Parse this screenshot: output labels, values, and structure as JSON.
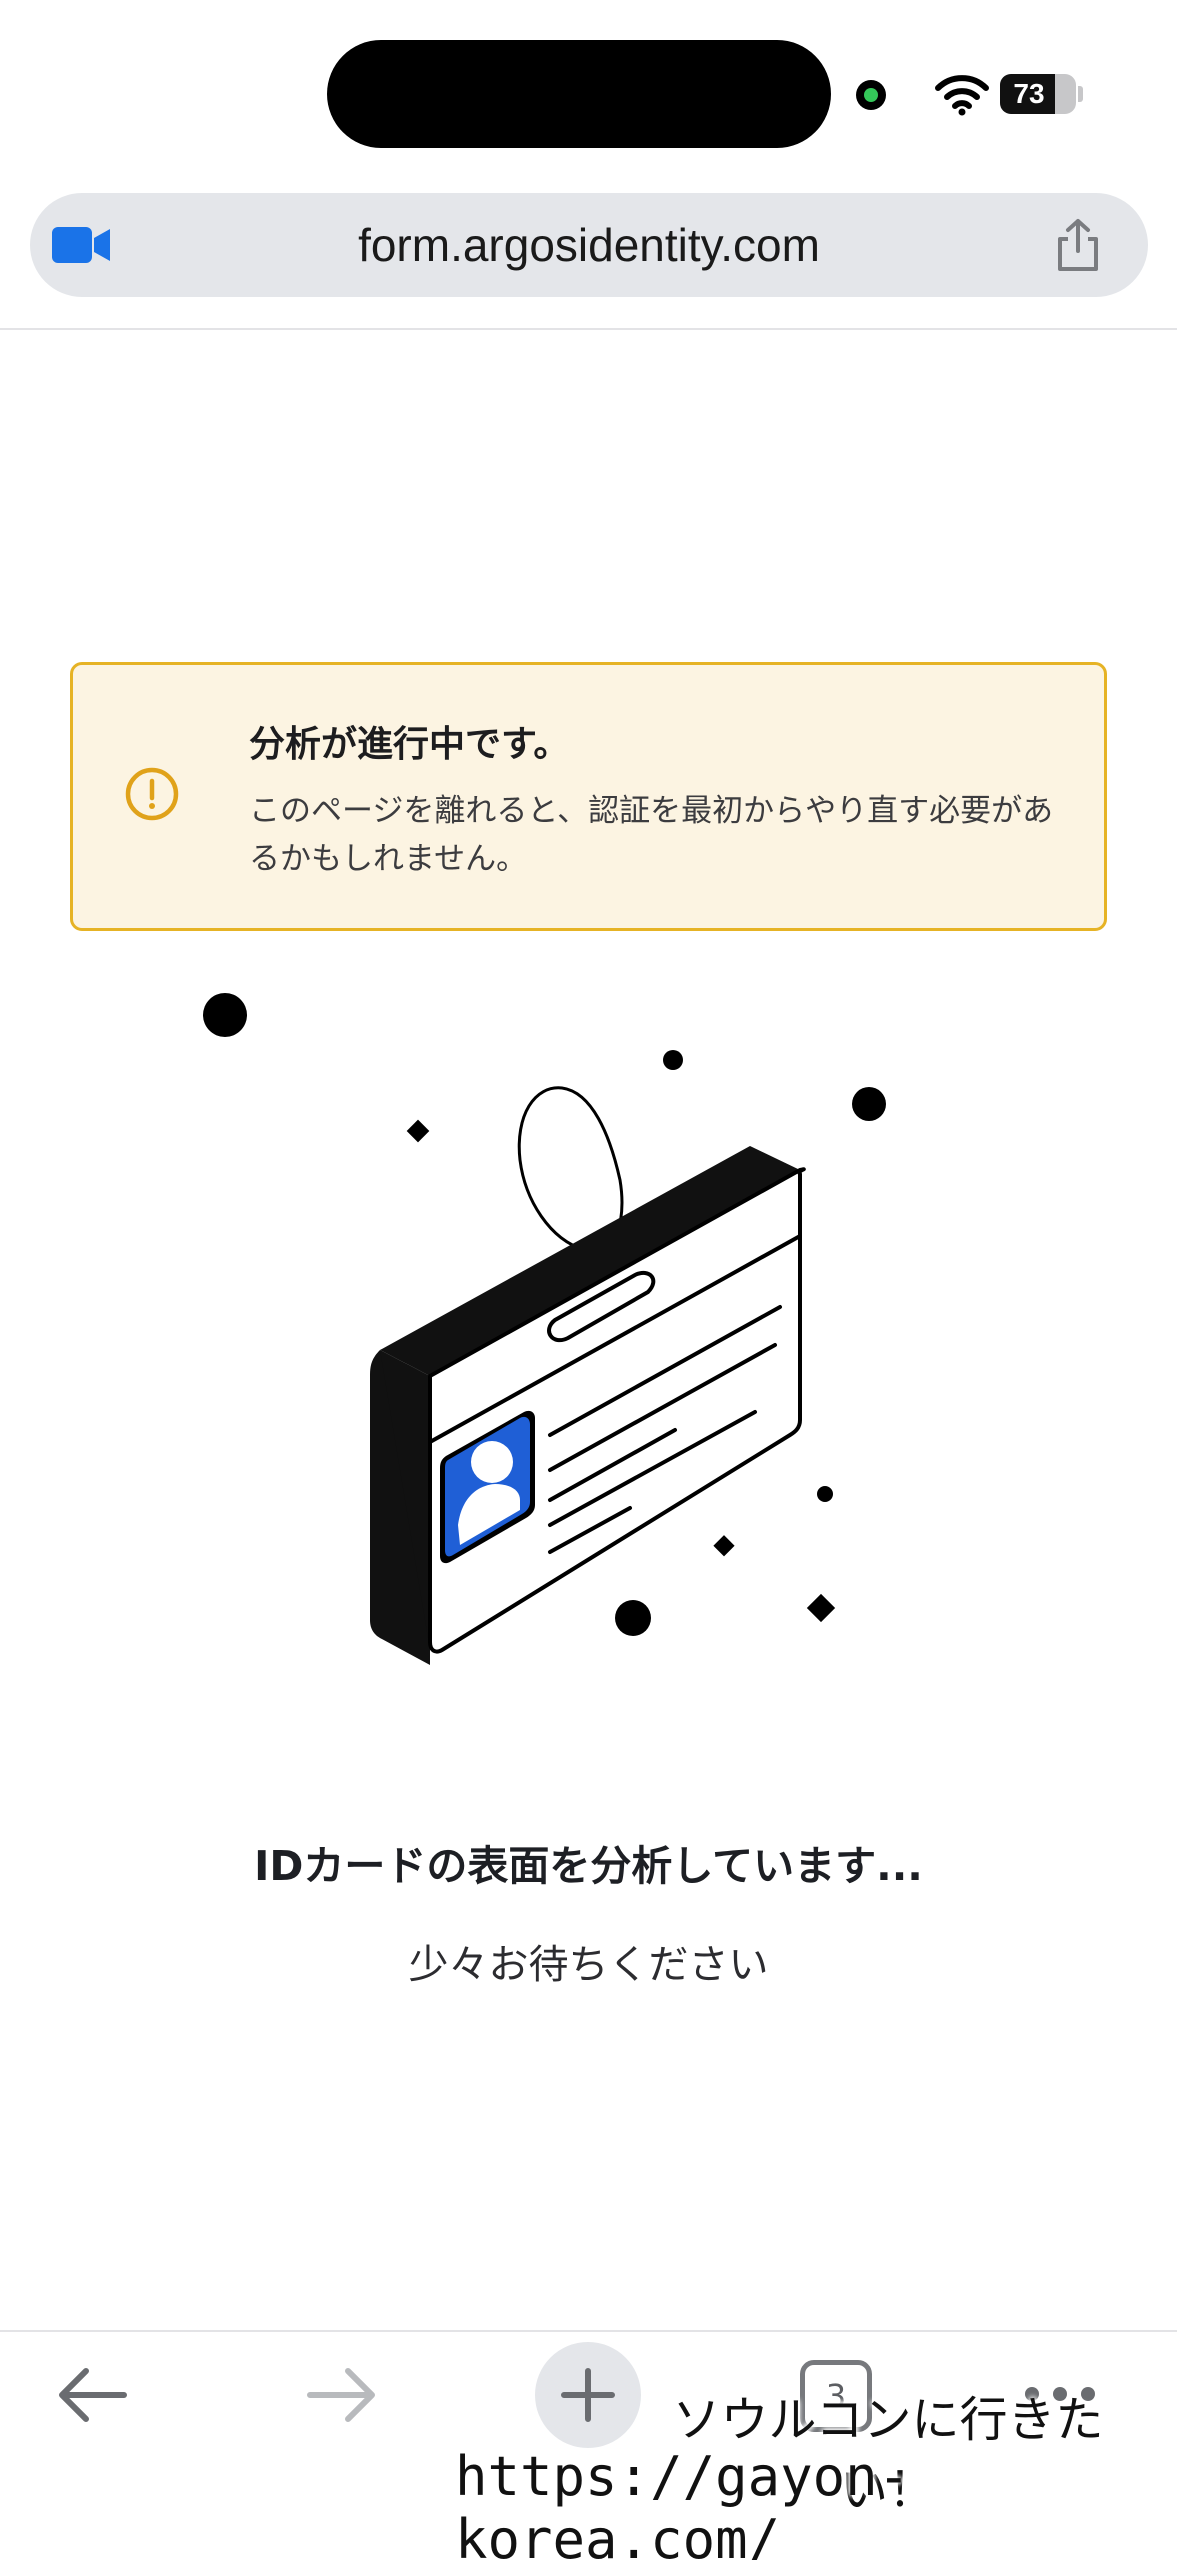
{
  "status_bar": {
    "battery_level": "73",
    "camera_indicator_color": "#34c759"
  },
  "browser": {
    "url": "form.argosidentity.com",
    "video_icon": "video-camera-icon",
    "share_icon": "share-icon"
  },
  "banner": {
    "title": "分析が進行中です。",
    "body": "このページを離れると、認証を最初からやり直す必要があるかもしれません。",
    "icon": "exclamation-circle-icon",
    "accent_color": "#e6b325",
    "background_color": "#fcf4e2"
  },
  "illustration": {
    "icon": "id-card-illustration",
    "photo_color": "#1f5fd6"
  },
  "main": {
    "title": "IDカードの表面を分析しています...",
    "subtitle": "少々お待ちください"
  },
  "toolbar": {
    "tabs_count": "3",
    "back_icon": "back-arrow-icon",
    "forward_icon": "forward-arrow-icon",
    "new_tab_icon": "plus-icon",
    "more_icon": "more-icon"
  },
  "watermark": {
    "line1": "ソウルコンに行きたい！",
    "line2": "https://gayon-korea.com/"
  }
}
